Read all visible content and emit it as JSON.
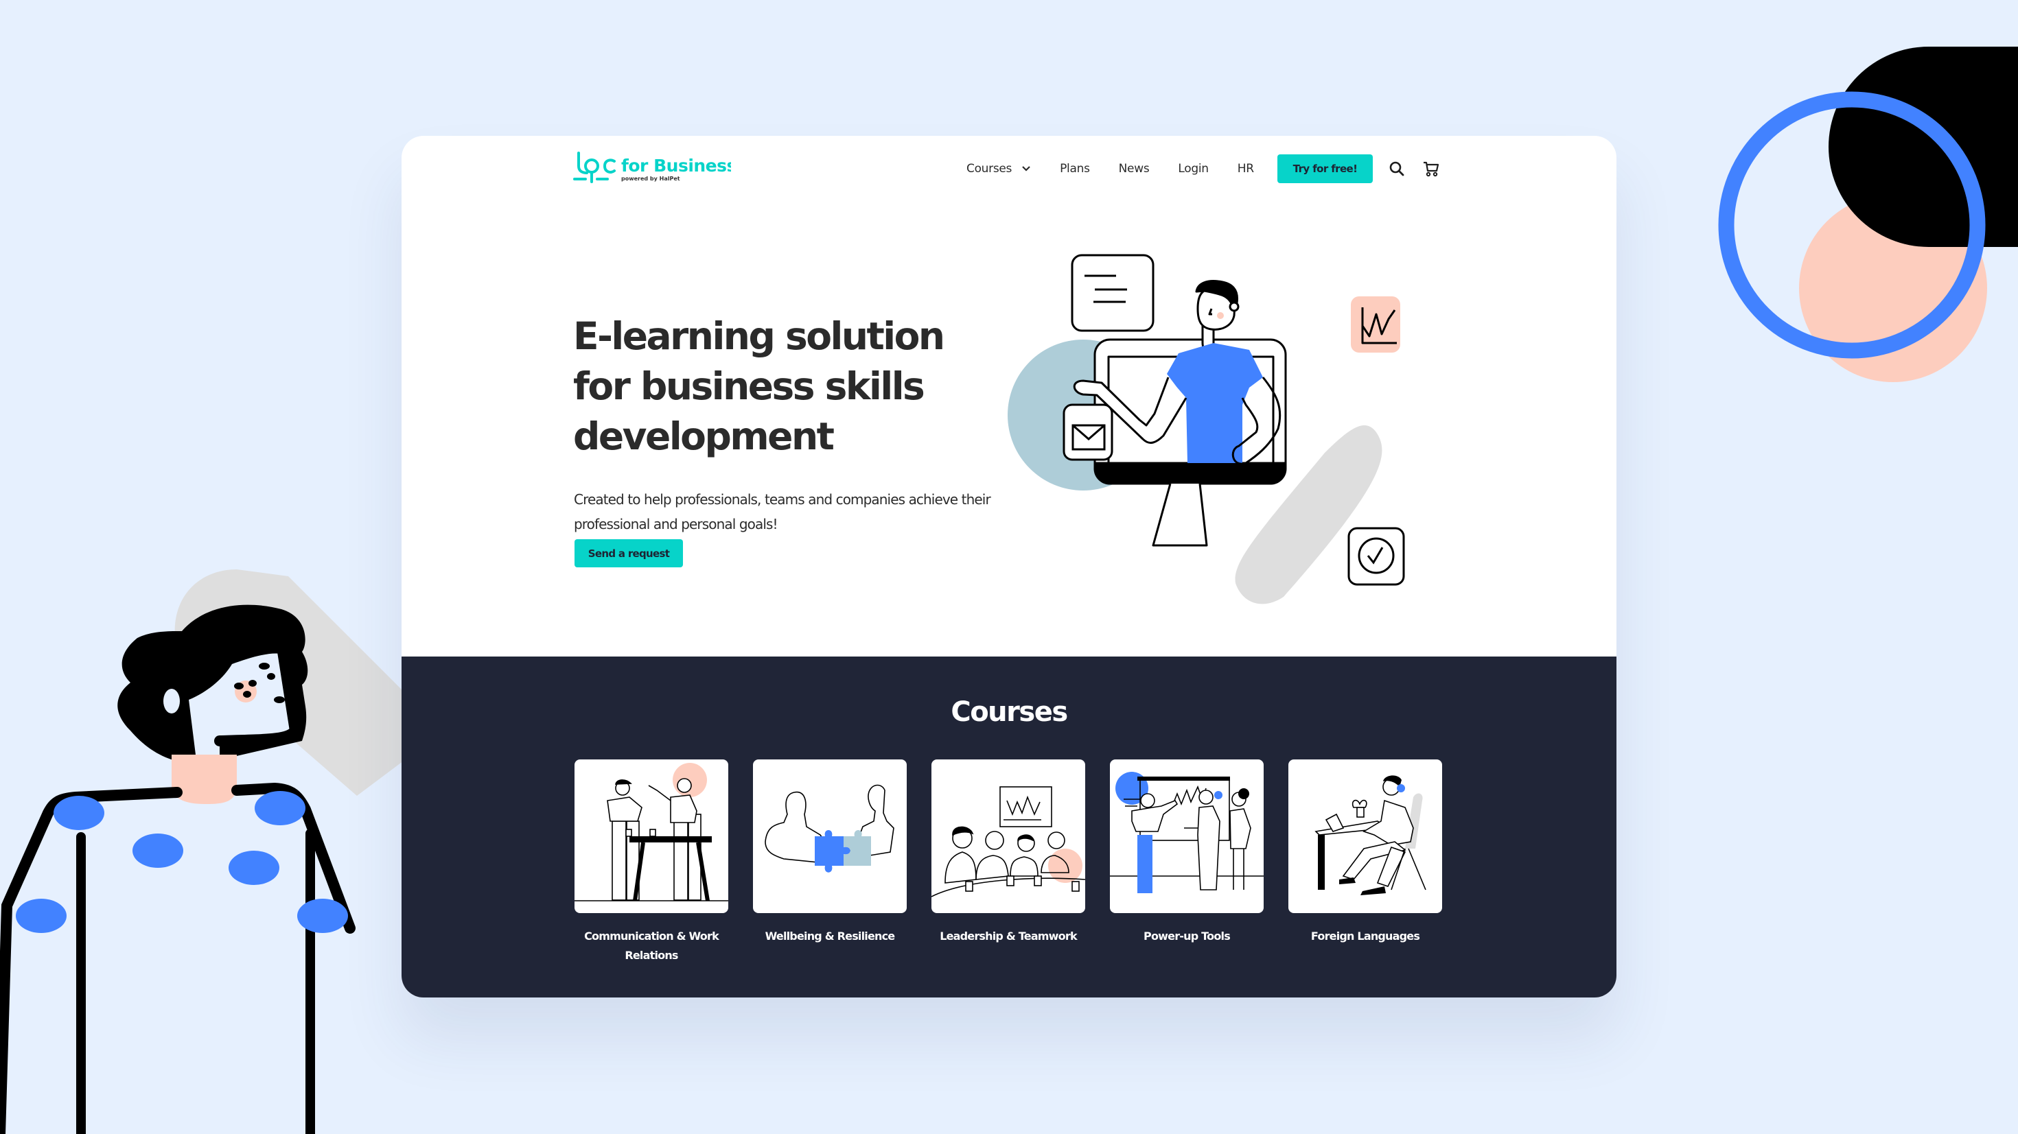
{
  "brand": {
    "name_prefix": "lpc",
    "name_suffix": "for Business",
    "tagline": "powered by HalPet",
    "accent_color": "#07d3c9"
  },
  "nav": {
    "items": [
      {
        "label": "Courses",
        "has_dropdown": true
      },
      {
        "label": "Plans"
      },
      {
        "label": "News"
      },
      {
        "label": "Login"
      },
      {
        "label": "HR"
      }
    ],
    "cta_label": "Try for free!",
    "icons": [
      "search-icon",
      "cart-icon"
    ]
  },
  "hero": {
    "title": "E-learning solution for business skills development",
    "subtitle": "Created to help professionals, teams and companies achieve their professional and personal goals!",
    "cta_label": "Send a request"
  },
  "courses": {
    "title": "Courses",
    "items": [
      {
        "label": "Communication & Work Relations",
        "illustration": "two-people-at-table"
      },
      {
        "label": "Wellbeing & Resilience",
        "illustration": "puzzle-pieces"
      },
      {
        "label": "Leadership & Teamwork",
        "illustration": "team-meeting"
      },
      {
        "label": "Power-up Tools",
        "illustration": "presentation-board"
      },
      {
        "label": "Foreign Languages",
        "illustration": "person-at-laptop"
      }
    ]
  },
  "colors": {
    "background": "#e6f0fe",
    "dark_section": "#202537",
    "blue": "#4282ff",
    "peach": "#fdcdbe",
    "teal_gray": "#aecdd8"
  }
}
